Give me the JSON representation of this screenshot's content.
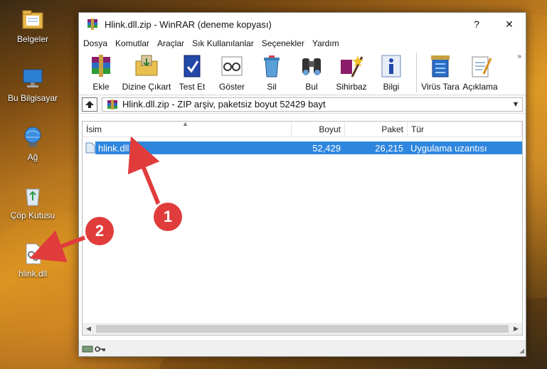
{
  "desktop": {
    "icons": [
      {
        "label": "Belgeler",
        "icon": "documents-folder-icon"
      },
      {
        "label": "Bu Bilgisayar",
        "icon": "computer-icon"
      },
      {
        "label": "Ağ",
        "icon": "network-icon"
      },
      {
        "label": "Çöp Kutusu",
        "icon": "recycle-bin-icon"
      },
      {
        "label": "hlink.dll",
        "icon": "dll-file-icon"
      }
    ]
  },
  "window": {
    "title": "Hlink.dll.zip - WinRAR (deneme kopyası)",
    "help_label": "?",
    "close_label": "✕"
  },
  "menu": [
    "Dosya",
    "Komutlar",
    "Araçlar",
    "Sık Kullanılanlar",
    "Seçenekler",
    "Yardım"
  ],
  "toolbar": {
    "buttons": [
      "Ekle",
      "Dizine Çıkart",
      "Test Et",
      "Göster",
      "Sil",
      "Bul",
      "Sihirbaz",
      "Bilgi",
      "Virüs Tara",
      "Açıklama"
    ],
    "more": "»"
  },
  "pathbar": {
    "text": "Hlink.dll.zip - ZIP arşiv, paketsiz boyut 52429 bayt"
  },
  "filelist": {
    "columns": {
      "name": "İsim",
      "size": "Boyut",
      "packed": "Paket",
      "type": "Tür"
    },
    "rows": [
      {
        "name": "hlink.dll",
        "size": "52,429",
        "packed": "26,215",
        "type": "Uygulama uzantısı"
      }
    ]
  },
  "callouts": [
    "1",
    "2"
  ],
  "colors": {
    "selection": "#2f86de",
    "callout": "#e03c3c"
  }
}
